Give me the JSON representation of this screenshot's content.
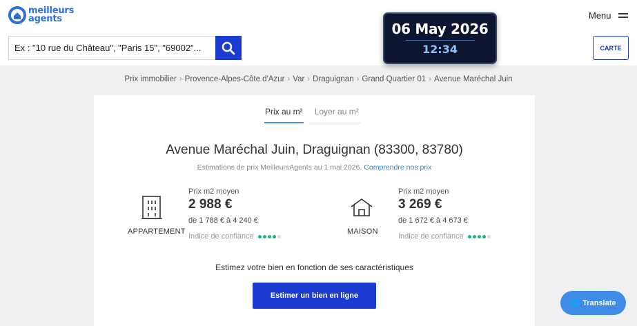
{
  "brand": {
    "line1": "meilleurs",
    "line2": "agents",
    "color": "#2d6fd6"
  },
  "search": {
    "placeholder": "Ex : \"10 rue du Château\", \"Paris 15\", \"69002\"...",
    "button_icon": "search-icon"
  },
  "clock": {
    "date": "06 May 2026",
    "time": "12:34"
  },
  "header": {
    "menu_label": "Menu",
    "carte_label": "CARTE"
  },
  "breadcrumb": [
    "Prix immobilier",
    "Provence-Alpes-Côte d'Azur",
    "Var",
    "Draguignan",
    "Grand Quartier 01",
    "Avenue Maréchal Juin"
  ],
  "tabs": [
    {
      "label": "Prix au m²",
      "active": true
    },
    {
      "label": "Loyer au m²",
      "active": false
    }
  ],
  "main": {
    "title": "Avenue Maréchal Juin, Draguignan (83300, 83780)",
    "subtitle": "Estimations de prix MeilleursAgents au 1 mai 2026.",
    "subtitle_link": "Comprendre nos prix"
  },
  "apartment": {
    "type_label": "APPARTEMENT",
    "icon": "building-icon",
    "price_label": "Prix m2 moyen",
    "price": "2 988 €",
    "range": "de 1 788 € à 4 240 €",
    "confidence_label": "Indice de confiance",
    "confidence_level": 4,
    "confidence_max": 5
  },
  "house": {
    "type_label": "MAISON",
    "icon": "house-icon",
    "price_label": "Prix m2 moyen",
    "price": "3 269 €",
    "range": "de 1 672 € à 4 673 €",
    "confidence_label": "Indice de confiance",
    "confidence_level": 4,
    "confidence_max": 5
  },
  "cta": {
    "text": "Estimez votre bien en fonction de ses caractéristiques",
    "button": "Estimer un bien en ligne"
  },
  "translate": {
    "label": "Translate",
    "icon": "globe-icon"
  },
  "colors": {
    "primary": "#1c3bd1",
    "confidence": "#1ab58a",
    "link": "#2d85d6"
  }
}
